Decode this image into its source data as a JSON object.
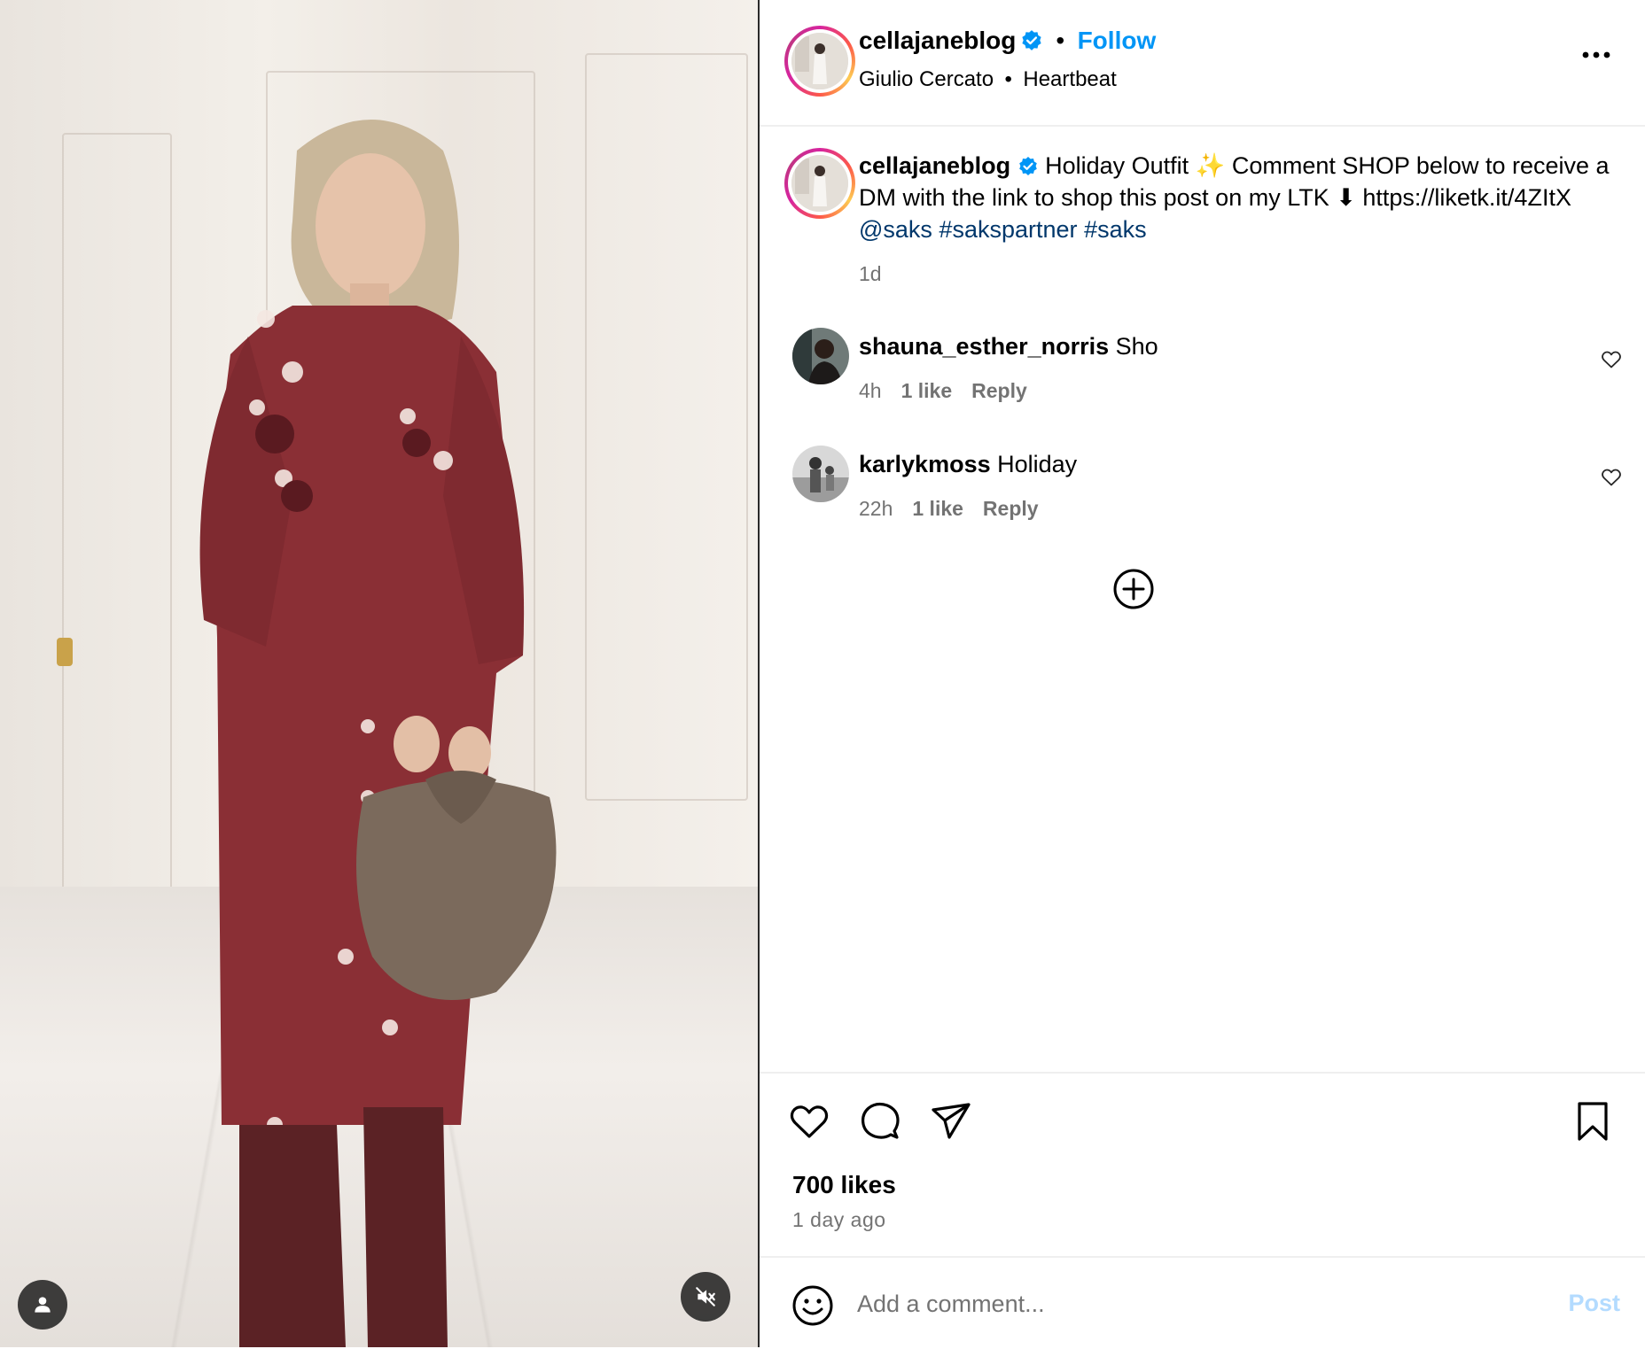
{
  "header": {
    "username": "cellajaneblog",
    "verified": true,
    "follow_label": "Follow",
    "separator": "•",
    "audio_artist": "Giulio Cercato",
    "audio_title": "Heartbeat",
    "more_icon": "more-horizontal-icon"
  },
  "caption": {
    "username": "cellajaneblog",
    "text_part1": "Holiday Outfit",
    "sparkles": "✨",
    "text_part2": "Comment SHOP below to receive a DM with the link to shop this post on my LTK",
    "arrow": "⬇",
    "link": "https://liketk.it/4ZItX",
    "mention": "@saks",
    "hashtag1": "#sakspartner",
    "hashtag2": "#saks",
    "time": "1d"
  },
  "comments": [
    {
      "username": "shauna_esther_norris",
      "text": "Sho",
      "time": "4h",
      "likes": "1 like",
      "reply": "Reply"
    },
    {
      "username": "karlykmoss",
      "text": "Holiday",
      "time": "22h",
      "likes": "1 like",
      "reply": "Reply"
    }
  ],
  "actions": {
    "likes": "700 likes",
    "posted": "1 day ago",
    "icons": [
      "heart-icon",
      "comment-icon",
      "share-icon",
      "bookmark-icon"
    ]
  },
  "comment_box": {
    "placeholder": "Add a comment...",
    "post_label": "Post"
  },
  "media": {
    "tag_icon": "user-tag-icon",
    "sound_icon": "muted-speaker-icon"
  },
  "colors": {
    "accent_blue": "#0095f6",
    "mention_blue": "#00376b",
    "muted_text": "#737373",
    "post_disabled": "#b3dbff",
    "dress": "#8a2f35"
  }
}
